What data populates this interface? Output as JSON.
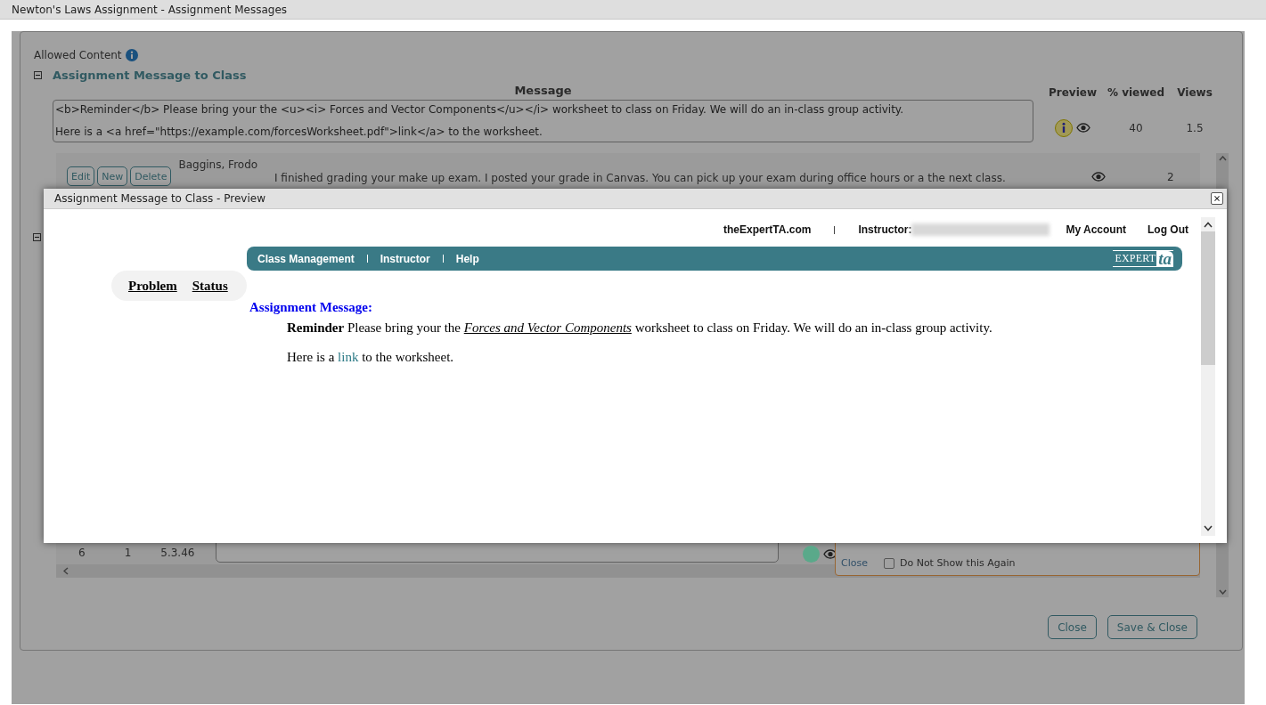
{
  "window": {
    "title": "Newton's Laws Assignment - Assignment Messages"
  },
  "allowed_content": {
    "label": "Allowed Content"
  },
  "sections": [
    {
      "title": "Assignment Message to Class",
      "expanded": true
    },
    {
      "expanded": true
    }
  ],
  "class_message": {
    "headers": {
      "message": "Message",
      "preview": "Preview",
      "viewed": "% viewed",
      "views": "Views"
    },
    "lines": [
      "<b>Reminder</b> Please bring your the <u><i> Forces and Vector Components</u></i> worksheet to class on Friday.  We will do an in-class group activity.",
      "Here is a <a href=\"https://example.com/forcesWorksheet.pdf\">link</a> to the worksheet."
    ],
    "percent_viewed": "40",
    "views": "1.5"
  },
  "student_messages": {
    "rows": [
      {
        "buttons": [
          "Edit",
          "New",
          "Delete"
        ],
        "student": "Baggins, Frodo",
        "message": "I finished grading your make up exam. I posted your grade in Canvas. You can pick up your exam during office hours or a the next class.",
        "views": "2"
      },
      {
        "column_1": "6",
        "column_2": "1",
        "column_3": "5.3.46",
        "color": "#5aa98a"
      }
    ],
    "popup": {
      "close": "Close",
      "do_not_show": {
        "label": "Do Not Show this Again",
        "checked": false
      }
    }
  },
  "footer_buttons": [
    "Close",
    "Save & Close"
  ],
  "preview": {
    "title": "Assignment Message to Class - Preview",
    "top_links": [
      "theExpertTA.com",
      "Instructor:",
      "My Account",
      "Log Out"
    ],
    "nav": [
      "Class Management",
      "Instructor",
      "Help"
    ],
    "logo": {
      "text": "EXPERT",
      "mark": "ta"
    },
    "tabs": [
      "Problem",
      "Status"
    ],
    "heading": "Assignment Message:",
    "paragraphs": [
      {
        "text": "**Reminder** Please bring your the *Forces and Vector Components* worksheet to class on Friday. We will do an in-class group activity."
      },
      {
        "before": "Here is a ",
        "link": "link",
        "after": " to the worksheet."
      }
    ]
  }
}
